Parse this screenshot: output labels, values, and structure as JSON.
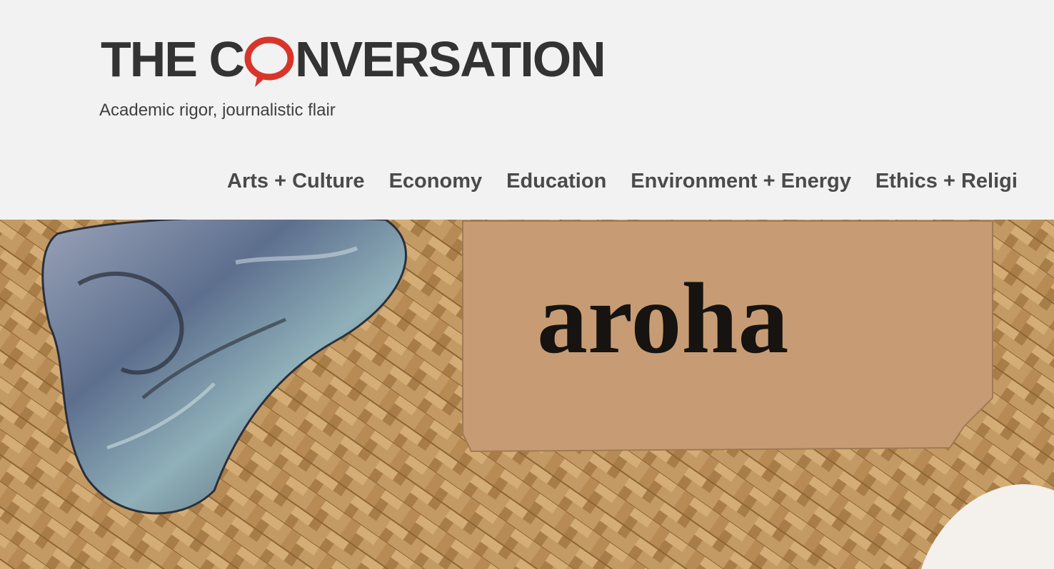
{
  "site": {
    "logo_text_left": "THE C",
    "logo_text_right": "NVERSATION",
    "tagline": "Academic rigor, journalistic flair",
    "brand_color": "#d8352a",
    "text_color": "#333333"
  },
  "nav": {
    "items": [
      {
        "label": "Arts + Culture"
      },
      {
        "label": "Economy"
      },
      {
        "label": "Education"
      },
      {
        "label": "Environment + Energy"
      },
      {
        "label": "Ethics + Religi"
      }
    ]
  },
  "hero": {
    "tag_text": "aroha",
    "description_icons": [
      "paua-shell",
      "woven-flax-mat",
      "paper-tag"
    ]
  }
}
